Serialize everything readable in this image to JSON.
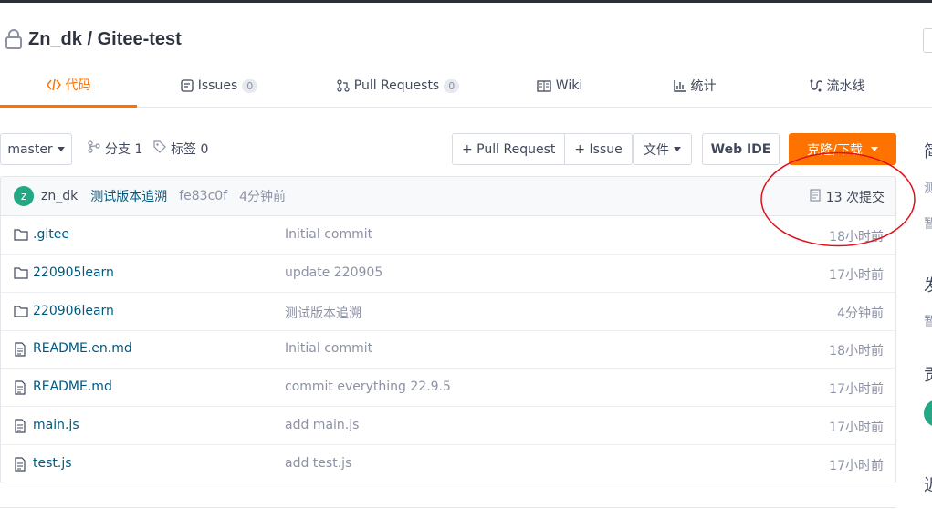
{
  "repo": {
    "owner": "Zn_dk",
    "separator": "/",
    "name": "Gitee-test"
  },
  "tabs": [
    {
      "label": "代码",
      "icon": "code-icon",
      "active": true
    },
    {
      "label": "Issues",
      "icon": "issues-icon",
      "badge": "0"
    },
    {
      "label": "Pull Requests",
      "icon": "pull-request-icon",
      "badge": "0"
    },
    {
      "label": "Wiki",
      "icon": "wiki-book-icon"
    },
    {
      "label": "统计",
      "icon": "stats-bar-icon"
    },
    {
      "label": "流水线",
      "icon": "pipeline-icon"
    }
  ],
  "toolbar": {
    "branch_select": "master",
    "branches_label": "分支 1",
    "tags_label": "标签 0",
    "pull_request_label": "+ Pull Request",
    "issue_label": "+ Issue",
    "file_label": "文件",
    "webide_label": "Web IDE",
    "clone_label": "克隆/下载",
    "clone_color": "#fe7300"
  },
  "commit": {
    "avatar_letter": "z",
    "author": "zn_dk",
    "message": "测试版本追溯",
    "sha": "fe83c0f",
    "time": "4分钟前",
    "count_label": "13 次提交"
  },
  "files": [
    {
      "type": "folder",
      "name": ".gitee",
      "message": "Initial commit",
      "time": "18小时前"
    },
    {
      "type": "folder",
      "name": "220905learn",
      "message": "update 220905",
      "time": "17小时前"
    },
    {
      "type": "folder",
      "name": "220906learn",
      "message": "测试版本追溯",
      "time": "4分钟前"
    },
    {
      "type": "file",
      "name": "README.en.md",
      "message": "Initial commit",
      "time": "18小时前"
    },
    {
      "type": "file",
      "name": "README.md",
      "message": "commit everything 22.9.5",
      "time": "17小时前"
    },
    {
      "type": "file",
      "name": "main.js",
      "message": "add main.js",
      "time": "17小时前"
    },
    {
      "type": "file",
      "name": "test.js",
      "message": "add test.js",
      "time": "17小时前"
    }
  ],
  "sidebar_fragments": [
    "简",
    "测",
    "暂",
    "发",
    "暂",
    "贡",
    "近"
  ],
  "colors": {
    "accent": "#fe7300",
    "link": "#005980",
    "annotation": "#e0101a"
  }
}
